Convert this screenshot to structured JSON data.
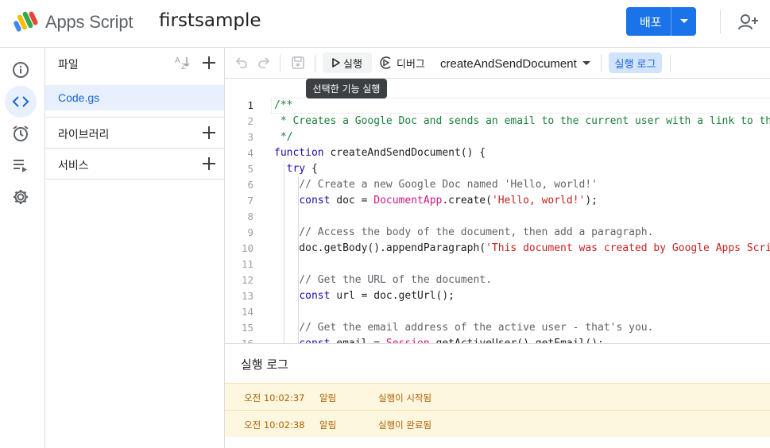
{
  "header": {
    "brand": "Apps Script",
    "project_name": "firstsample",
    "deploy_label": "배포"
  },
  "files_panel": {
    "title": "파일",
    "files": [
      {
        "name": "Code.gs"
      }
    ],
    "libraries_label": "라이브러리",
    "services_label": "서비스"
  },
  "toolbar": {
    "run_label": "실행",
    "debug_label": "디버그",
    "function_name": "createAndSendDocument",
    "log_label": "실행 로그",
    "tooltip": "선택한 기능 실행"
  },
  "editor": {
    "line_numbers": [
      "1",
      "2",
      "3",
      "4",
      "5",
      "6",
      "7",
      "8",
      "9",
      "10",
      "11",
      "12",
      "13",
      "14",
      "15",
      "16"
    ],
    "active_line": 1,
    "lines": [
      [
        {
          "t": "/**",
          "c": "cm"
        }
      ],
      [
        {
          "t": " * Creates a Google Doc and sends an email to the current user with a link to th",
          "c": "cm"
        }
      ],
      [
        {
          "t": " */",
          "c": "cm"
        }
      ],
      [
        {
          "t": "function",
          "c": "kw"
        },
        {
          "t": " createAndSendDocument() {",
          "c": "plain"
        }
      ],
      [
        {
          "t": "  ",
          "c": "plain"
        },
        {
          "t": "try",
          "c": "kw"
        },
        {
          "t": " {",
          "c": "plain"
        }
      ],
      [
        {
          "t": "    // Create a new Google Doc named 'Hello, world!'",
          "c": "gray"
        }
      ],
      [
        {
          "t": "    ",
          "c": "plain"
        },
        {
          "t": "const",
          "c": "kw"
        },
        {
          "t": " doc = ",
          "c": "plain"
        },
        {
          "t": "DocumentApp",
          "c": "cls"
        },
        {
          "t": ".create(",
          "c": "plain"
        },
        {
          "t": "'Hello, world!'",
          "c": "str"
        },
        {
          "t": ");",
          "c": "plain"
        }
      ],
      [
        {
          "t": "",
          "c": "plain"
        }
      ],
      [
        {
          "t": "    // Access the body of the document, then add a paragraph.",
          "c": "gray"
        }
      ],
      [
        {
          "t": "    doc.getBody().appendParagraph(",
          "c": "plain"
        },
        {
          "t": "'This document was created by Google Apps Scri",
          "c": "str"
        }
      ],
      [
        {
          "t": "",
          "c": "plain"
        }
      ],
      [
        {
          "t": "    // Get the URL of the document.",
          "c": "gray"
        }
      ],
      [
        {
          "t": "    ",
          "c": "plain"
        },
        {
          "t": "const",
          "c": "kw"
        },
        {
          "t": " url = doc.getUrl();",
          "c": "plain"
        }
      ],
      [
        {
          "t": "",
          "c": "plain"
        }
      ],
      [
        {
          "t": "    // Get the email address of the active user - that's you.",
          "c": "gray"
        }
      ],
      [
        {
          "t": "    ",
          "c": "plain"
        },
        {
          "t": "const",
          "c": "kw"
        },
        {
          "t": " email = ",
          "c": "plain"
        },
        {
          "t": "Session",
          "c": "cls"
        },
        {
          "t": ".getActiveUser().getEmail();",
          "c": "plain"
        }
      ]
    ]
  },
  "log_panel": {
    "title": "실행 로그",
    "entries": [
      {
        "time": "오전 10:02:37",
        "level": "알림",
        "message": "실행이 시작됨"
      },
      {
        "time": "오전 10:02:38",
        "level": "알림",
        "message": "실행이 완료됨"
      }
    ]
  },
  "colors": {
    "accent": "#1a73e8",
    "selected_bg": "#e8f0fe",
    "log_bg": "#fef7e0",
    "log_text": "#b06000"
  },
  "icons": [
    "apps-script-logo-icon",
    "chevron-down-icon",
    "add-person-icon",
    "info-icon",
    "code-icon",
    "alarm-clock-icon",
    "executions-icon",
    "gear-icon",
    "sort-az-icon",
    "plus-icon",
    "undo-icon",
    "redo-icon",
    "save-icon",
    "play-icon",
    "debug-icon"
  ]
}
